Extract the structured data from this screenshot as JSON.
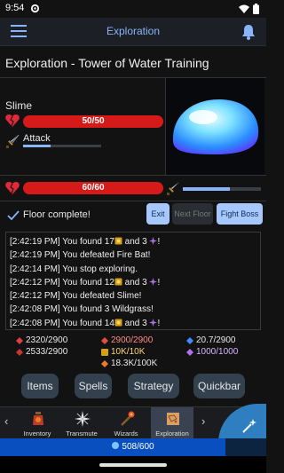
{
  "status_bar": {
    "time": "9:54",
    "icons": [
      "settings-gear-icon",
      "wifi-icon",
      "battery-icon"
    ]
  },
  "app_bar": {
    "title": "Exploration",
    "menu_icon": "hamburger-menu-icon",
    "notification_icon": "bell-icon"
  },
  "heading": "Exploration - Tower of Water Training",
  "enemy": {
    "name": "Slime",
    "hp_text": "50/50",
    "hp_fraction": 1.0,
    "attack_label": "Attack",
    "attack_progress_fraction": 0.35,
    "portrait": "slime-portrait"
  },
  "player": {
    "hp_text": "60/60",
    "hp_fraction": 1.0,
    "attack_progress_fraction": 0.6
  },
  "floor": {
    "status": "Floor complete!",
    "exit_label": "Exit",
    "next_floor_label": "Next Floor",
    "fight_boss_label": "Fight Boss"
  },
  "log": [
    {
      "prefix": "[2:42:19 PM] You found 17",
      "mid": " and 3 ",
      "suffix": "!",
      "icons": true
    },
    {
      "text": "[2:42:19 PM] You defeated Fire Bat!"
    },
    {
      "text": "[2:42:14 PM] You stop exploring."
    },
    {
      "prefix": "[2:42:12 PM] You found 12",
      "mid": " and 3 ",
      "suffix": "!",
      "icons": true
    },
    {
      "text": "[2:42:12 PM] You defeated Slime!"
    },
    {
      "text": "[2:42:08 PM] You found 3 Wildgrass!"
    },
    {
      "prefix": "[2:42:08 PM] You found 14",
      "mid": " and 3 ",
      "suffix": "!",
      "icons": true
    }
  ],
  "resources": {
    "red_gem_1": "2320/2900",
    "red_gem_2": "2533/2900",
    "red_crystal": "2900/2900",
    "gold": "10K/10K",
    "fire_gem": "18.3K/100K",
    "blue_gem": "20.7/2900",
    "purple_gem": "1000/1000"
  },
  "actions": {
    "items": "Items",
    "spells": "Spells",
    "strategy": "Strategy",
    "quickbar": "Quickbar"
  },
  "tabs": [
    {
      "label": "Inventory",
      "icon": "potion-jar-icon"
    },
    {
      "label": "Transmute",
      "icon": "sparkle-burst-icon"
    },
    {
      "label": "Wizards",
      "icon": "wand-staff-icon"
    },
    {
      "label": "Exploration",
      "icon": "map-scroll-icon"
    }
  ],
  "fab_icon": "magic-wand-icon",
  "mana": {
    "text": "508/600",
    "fraction": 0.847
  },
  "colors": {
    "accent": "#8ab4f8",
    "hp_red": "#d61a1a",
    "button_blue": "#a6c8ff",
    "mana_blue": "#0a4fbf"
  }
}
